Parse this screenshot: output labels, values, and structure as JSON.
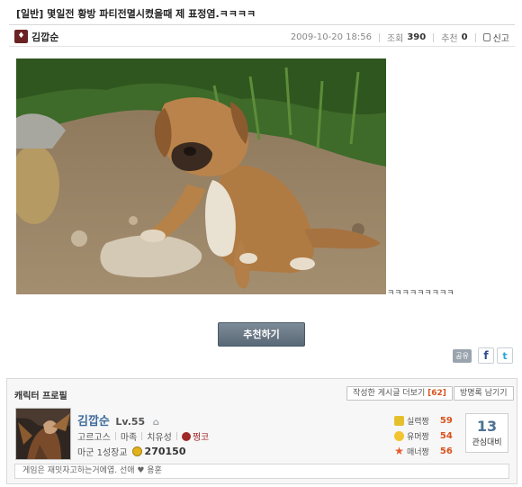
{
  "post": {
    "title": "[일반] 몇일전 황방 파티전멸시켰을때 제 표정염.ㅋㅋㅋㅋ",
    "author_name": "김깝순",
    "date": "2009-10-20 18:56",
    "views_label": "조회",
    "views": "390",
    "recommend_label": "추천",
    "recommend": "0",
    "report_label": "신고",
    "body_text": "ㅋㅋㅋㅋㅋㅋㅋㅋㅋ",
    "recommend_button": "추천하기"
  },
  "share": {
    "label": "공유",
    "facebook": "f",
    "twitter": "t"
  },
  "profile": {
    "header": "캐릭터 프로필",
    "more_posts_label": "작성한 게시글 더보기",
    "more_posts_count": "[62]",
    "guestbook_label": "방명록 남기기",
    "name": "김깝순",
    "level": "Lv.55",
    "server": "고르고스",
    "race": "마족",
    "class": "치유성",
    "guild": "쩡코",
    "rank": "마군 1성장교",
    "points": "270150",
    "stats": [
      {
        "label": "실력짱",
        "value": "59",
        "icon": "crown-icon"
      },
      {
        "label": "유머짱",
        "value": "54",
        "icon": "smile-icon"
      },
      {
        "label": "매너짱",
        "value": "56",
        "icon": "star-icon"
      }
    ],
    "interest_value": "13",
    "interest_label": "관심대비",
    "comment": "게임은 재밋자고하는거에엽. 선애 ♥ 용훈"
  }
}
